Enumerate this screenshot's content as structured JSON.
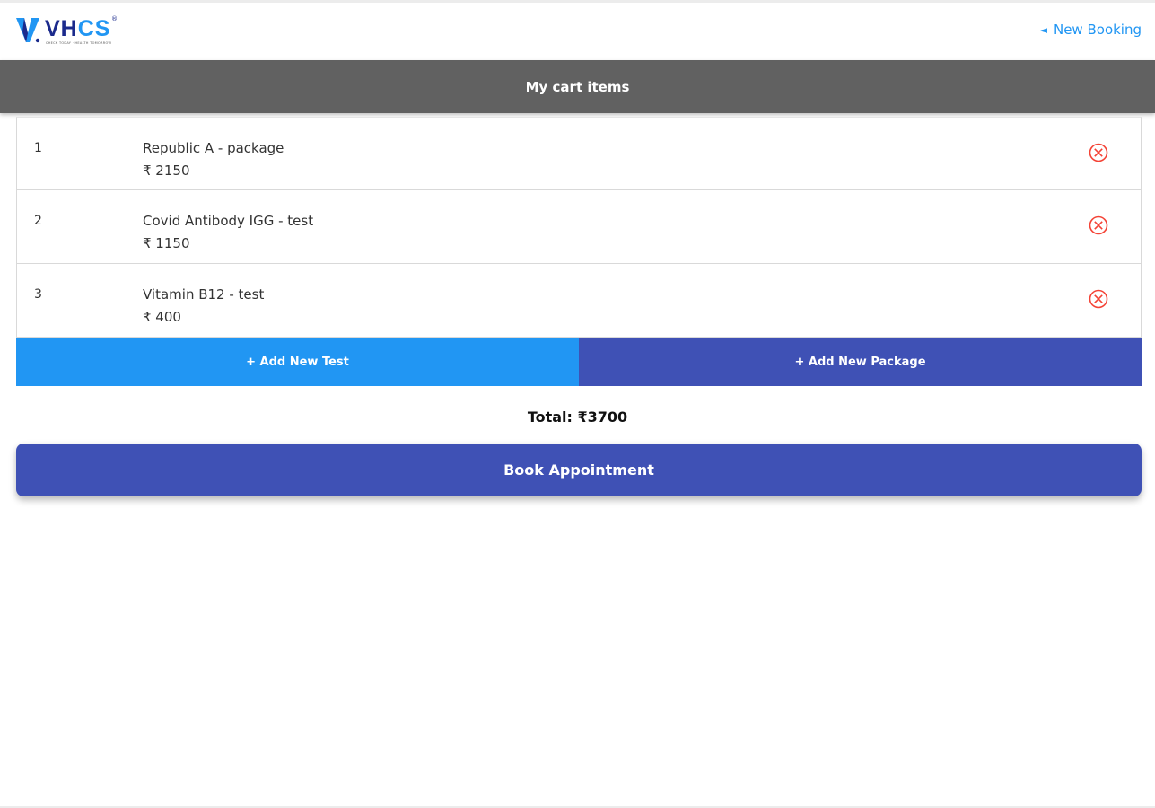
{
  "header": {
    "logo_text_vh": "VH",
    "logo_text_cs": "CS",
    "logo_registered": "®",
    "logo_tagline": "CHECK TODAY · HEALTH TOMORROW",
    "new_booking_arrow": "◄",
    "new_booking_label": "New Booking"
  },
  "title_bar": {
    "title": "My cart items"
  },
  "cart": {
    "items": [
      {
        "index": "1",
        "name": "Republic A - package",
        "price": "₹ 2150"
      },
      {
        "index": "2",
        "name": "Covid Antibody IGG - test",
        "price": "₹ 1150"
      },
      {
        "index": "3",
        "name": "Vitamin B12 - test",
        "price": "₹ 400"
      }
    ],
    "remove_icon": "remove-circle-icon"
  },
  "actions": {
    "add_test_label": "+ Add New Test",
    "add_package_label": "+ Add New Package"
  },
  "summary": {
    "total_label": "Total: ₹3700",
    "book_label": "Book Appointment"
  },
  "colors": {
    "header_bar": "#616161",
    "primary_blue": "#2196f3",
    "indigo": "#3f51b5",
    "remove_red": "#f44336",
    "logo_navy": "#1b2a8c"
  }
}
